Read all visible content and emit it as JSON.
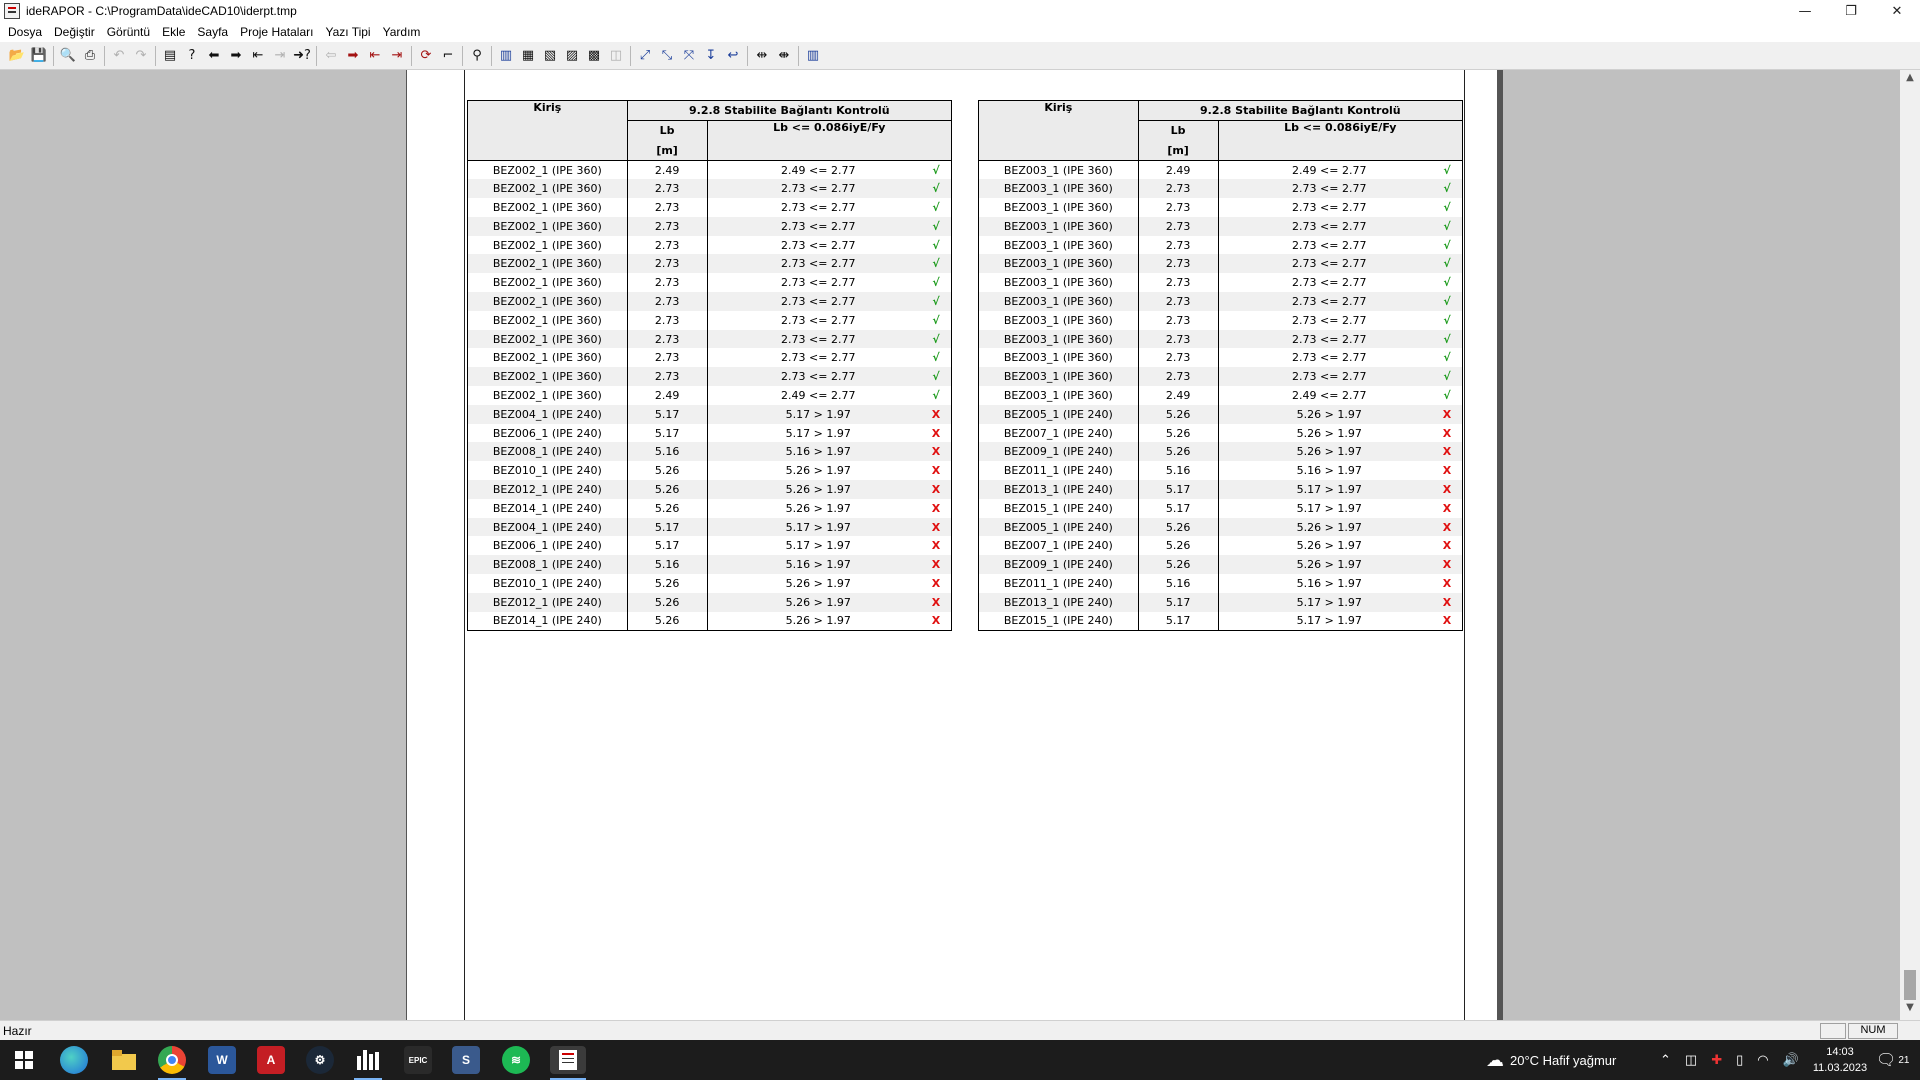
{
  "window": {
    "title": "ideRAPOR - C:\\ProgramData\\ideCAD10\\iderpt.tmp",
    "controls": {
      "minimize": "—",
      "restore": "❐",
      "close": "✕"
    }
  },
  "menu": [
    "Dosya",
    "Değiştir",
    "Görüntü",
    "Ekle",
    "Sayfa",
    "Proje Hataları",
    "Yazı Tipi",
    "Yardım"
  ],
  "toolbar": {
    "groups": [
      [
        {
          "icon": "open-folder-icon",
          "glyph": "📂"
        },
        {
          "icon": "save-icon",
          "glyph": "💾"
        }
      ],
      [
        {
          "icon": "print-preview-icon",
          "glyph": "🔍"
        },
        {
          "icon": "print-icon",
          "glyph": "⎙"
        }
      ],
      [
        {
          "icon": "undo-icon",
          "glyph": "↶",
          "disabled": true
        },
        {
          "icon": "redo-icon",
          "glyph": "↷",
          "disabled": true
        }
      ],
      [
        {
          "icon": "page-icon",
          "glyph": "▤"
        },
        {
          "icon": "help-icon",
          "glyph": "?"
        },
        {
          "icon": "arrow-left-icon",
          "glyph": "⬅"
        },
        {
          "icon": "arrow-right-icon",
          "glyph": "➡"
        },
        {
          "icon": "first-page-icon",
          "glyph": "⇤"
        },
        {
          "icon": "last-page-icon",
          "glyph": "⇥",
          "disabled": true
        },
        {
          "icon": "goto-page-icon",
          "glyph": "➜?"
        }
      ],
      [
        {
          "icon": "prev-error-icon",
          "glyph": "⇦",
          "disabled": true
        },
        {
          "icon": "next-error-icon",
          "glyph": "➡",
          "red": true
        },
        {
          "icon": "first-error-icon",
          "glyph": "⇤",
          "red": true
        },
        {
          "icon": "last-error-icon",
          "glyph": "⇥",
          "red": true
        }
      ],
      [
        {
          "icon": "refresh-icon",
          "glyph": "⟳",
          "red": true
        },
        {
          "icon": "cursor-icon",
          "glyph": "⌐"
        }
      ],
      [
        {
          "icon": "tree-icon",
          "glyph": "⚲"
        }
      ],
      [
        {
          "icon": "layout-1-icon",
          "glyph": "▥",
          "blue": true
        },
        {
          "icon": "layout-2-icon",
          "glyph": "▦"
        },
        {
          "icon": "layout-3-icon",
          "glyph": "▧"
        },
        {
          "icon": "layout-4-icon",
          "glyph": "▨"
        },
        {
          "icon": "layout-5-icon",
          "glyph": "▩"
        },
        {
          "icon": "layout-6-icon",
          "glyph": "◫",
          "disabled": true
        }
      ],
      [
        {
          "icon": "zoom-1-icon",
          "glyph": "⤢",
          "blue": true
        },
        {
          "icon": "zoom-2-icon",
          "glyph": "⤡",
          "blue": true
        },
        {
          "icon": "zoom-3-icon",
          "glyph": "⤧",
          "blue": true
        },
        {
          "icon": "zoom-4-icon",
          "glyph": "↧",
          "blue": true
        },
        {
          "icon": "zoom-5-icon",
          "glyph": "↩",
          "blue": true
        }
      ],
      [
        {
          "icon": "fit-width-icon",
          "glyph": "⇹"
        },
        {
          "icon": "fit-page-icon",
          "glyph": "⇼"
        }
      ],
      [
        {
          "icon": "columns-icon",
          "glyph": "▥",
          "blue": true
        }
      ]
    ]
  },
  "tables": [
    {
      "header": {
        "col1": "Kiriş",
        "group": "9.2.8 Stabilite Bağlantı Kontrolü",
        "col2": "Lb",
        "col2_unit": "[m]",
        "col3": "Lb <= 0.086iyE/Fy"
      },
      "rows": [
        [
          "BEZ002_1 (IPE 360)",
          "2.49",
          "2.49 <= 2.77",
          "ok"
        ],
        [
          "BEZ002_1 (IPE 360)",
          "2.73",
          "2.73 <= 2.77",
          "ok"
        ],
        [
          "BEZ002_1 (IPE 360)",
          "2.73",
          "2.73 <= 2.77",
          "ok"
        ],
        [
          "BEZ002_1 (IPE 360)",
          "2.73",
          "2.73 <= 2.77",
          "ok"
        ],
        [
          "BEZ002_1 (IPE 360)",
          "2.73",
          "2.73 <= 2.77",
          "ok"
        ],
        [
          "BEZ002_1 (IPE 360)",
          "2.73",
          "2.73 <= 2.77",
          "ok"
        ],
        [
          "BEZ002_1 (IPE 360)",
          "2.73",
          "2.73 <= 2.77",
          "ok"
        ],
        [
          "BEZ002_1 (IPE 360)",
          "2.73",
          "2.73 <= 2.77",
          "ok"
        ],
        [
          "BEZ002_1 (IPE 360)",
          "2.73",
          "2.73 <= 2.77",
          "ok"
        ],
        [
          "BEZ002_1 (IPE 360)",
          "2.73",
          "2.73 <= 2.77",
          "ok"
        ],
        [
          "BEZ002_1 (IPE 360)",
          "2.73",
          "2.73 <= 2.77",
          "ok"
        ],
        [
          "BEZ002_1 (IPE 360)",
          "2.73",
          "2.73 <= 2.77",
          "ok"
        ],
        [
          "BEZ002_1 (IPE 360)",
          "2.49",
          "2.49 <= 2.77",
          "ok"
        ],
        [
          "BEZ004_1 (IPE 240)",
          "5.17",
          "5.17 > 1.97",
          "fail"
        ],
        [
          "BEZ006_1 (IPE 240)",
          "5.17",
          "5.17 > 1.97",
          "fail"
        ],
        [
          "BEZ008_1 (IPE 240)",
          "5.16",
          "5.16 > 1.97",
          "fail"
        ],
        [
          "BEZ010_1 (IPE 240)",
          "5.26",
          "5.26 > 1.97",
          "fail"
        ],
        [
          "BEZ012_1 (IPE 240)",
          "5.26",
          "5.26 > 1.97",
          "fail"
        ],
        [
          "BEZ014_1 (IPE 240)",
          "5.26",
          "5.26 > 1.97",
          "fail"
        ],
        [
          "BEZ004_1 (IPE 240)",
          "5.17",
          "5.17 > 1.97",
          "fail"
        ],
        [
          "BEZ006_1 (IPE 240)",
          "5.17",
          "5.17 > 1.97",
          "fail"
        ],
        [
          "BEZ008_1 (IPE 240)",
          "5.16",
          "5.16 > 1.97",
          "fail"
        ],
        [
          "BEZ010_1 (IPE 240)",
          "5.26",
          "5.26 > 1.97",
          "fail"
        ],
        [
          "BEZ012_1 (IPE 240)",
          "5.26",
          "5.26 > 1.97",
          "fail"
        ],
        [
          "BEZ014_1 (IPE 240)",
          "5.26",
          "5.26 > 1.97",
          "fail"
        ]
      ]
    },
    {
      "header": {
        "col1": "Kiriş",
        "group": "9.2.8 Stabilite Bağlantı Kontrolü",
        "col2": "Lb",
        "col2_unit": "[m]",
        "col3": "Lb <= 0.086iyE/Fy"
      },
      "rows": [
        [
          "BEZ003_1 (IPE 360)",
          "2.49",
          "2.49 <= 2.77",
          "ok"
        ],
        [
          "BEZ003_1 (IPE 360)",
          "2.73",
          "2.73 <= 2.77",
          "ok"
        ],
        [
          "BEZ003_1 (IPE 360)",
          "2.73",
          "2.73 <= 2.77",
          "ok"
        ],
        [
          "BEZ003_1 (IPE 360)",
          "2.73",
          "2.73 <= 2.77",
          "ok"
        ],
        [
          "BEZ003_1 (IPE 360)",
          "2.73",
          "2.73 <= 2.77",
          "ok"
        ],
        [
          "BEZ003_1 (IPE 360)",
          "2.73",
          "2.73 <= 2.77",
          "ok"
        ],
        [
          "BEZ003_1 (IPE 360)",
          "2.73",
          "2.73 <= 2.77",
          "ok"
        ],
        [
          "BEZ003_1 (IPE 360)",
          "2.73",
          "2.73 <= 2.77",
          "ok"
        ],
        [
          "BEZ003_1 (IPE 360)",
          "2.73",
          "2.73 <= 2.77",
          "ok"
        ],
        [
          "BEZ003_1 (IPE 360)",
          "2.73",
          "2.73 <= 2.77",
          "ok"
        ],
        [
          "BEZ003_1 (IPE 360)",
          "2.73",
          "2.73 <= 2.77",
          "ok"
        ],
        [
          "BEZ003_1 (IPE 360)",
          "2.73",
          "2.73 <= 2.77",
          "ok"
        ],
        [
          "BEZ003_1 (IPE 360)",
          "2.49",
          "2.49 <= 2.77",
          "ok"
        ],
        [
          "BEZ005_1 (IPE 240)",
          "5.26",
          "5.26 > 1.97",
          "fail"
        ],
        [
          "BEZ007_1 (IPE 240)",
          "5.26",
          "5.26 > 1.97",
          "fail"
        ],
        [
          "BEZ009_1 (IPE 240)",
          "5.26",
          "5.26 > 1.97",
          "fail"
        ],
        [
          "BEZ011_1 (IPE 240)",
          "5.16",
          "5.16 > 1.97",
          "fail"
        ],
        [
          "BEZ013_1 (IPE 240)",
          "5.17",
          "5.17 > 1.97",
          "fail"
        ],
        [
          "BEZ015_1 (IPE 240)",
          "5.17",
          "5.17 > 1.97",
          "fail"
        ],
        [
          "BEZ005_1 (IPE 240)",
          "5.26",
          "5.26 > 1.97",
          "fail"
        ],
        [
          "BEZ007_1 (IPE 240)",
          "5.26",
          "5.26 > 1.97",
          "fail"
        ],
        [
          "BEZ009_1 (IPE 240)",
          "5.26",
          "5.26 > 1.97",
          "fail"
        ],
        [
          "BEZ011_1 (IPE 240)",
          "5.16",
          "5.16 > 1.97",
          "fail"
        ],
        [
          "BEZ013_1 (IPE 240)",
          "5.17",
          "5.17 > 1.97",
          "fail"
        ],
        [
          "BEZ015_1 (IPE 240)",
          "5.17",
          "5.17 > 1.97",
          "fail"
        ]
      ]
    }
  ],
  "symbols": {
    "ok": "√",
    "fail": "X"
  },
  "colors": {
    "ok": "#1a9a1a",
    "fail": "#e01010",
    "row_alt": "#f0f0f0",
    "header_bg": "#ebebeb",
    "workspace": "#c0c0c0"
  },
  "statusbar": {
    "text": "Hazır",
    "num": "NUM"
  },
  "taskbar": {
    "weather": "20°C  Hafif yağmur",
    "time": "14:03",
    "date": "11.03.2023",
    "notifications": "21",
    "apps": [
      "start-icon",
      "edge-icon",
      "explorer-icon",
      "chrome-icon",
      "word-icon",
      "autocad-icon",
      "steam-icon",
      "ideCAD-icon",
      "epic-games-icon",
      "sap-icon",
      "spotify-icon",
      "ideRAPOR-icon"
    ]
  }
}
